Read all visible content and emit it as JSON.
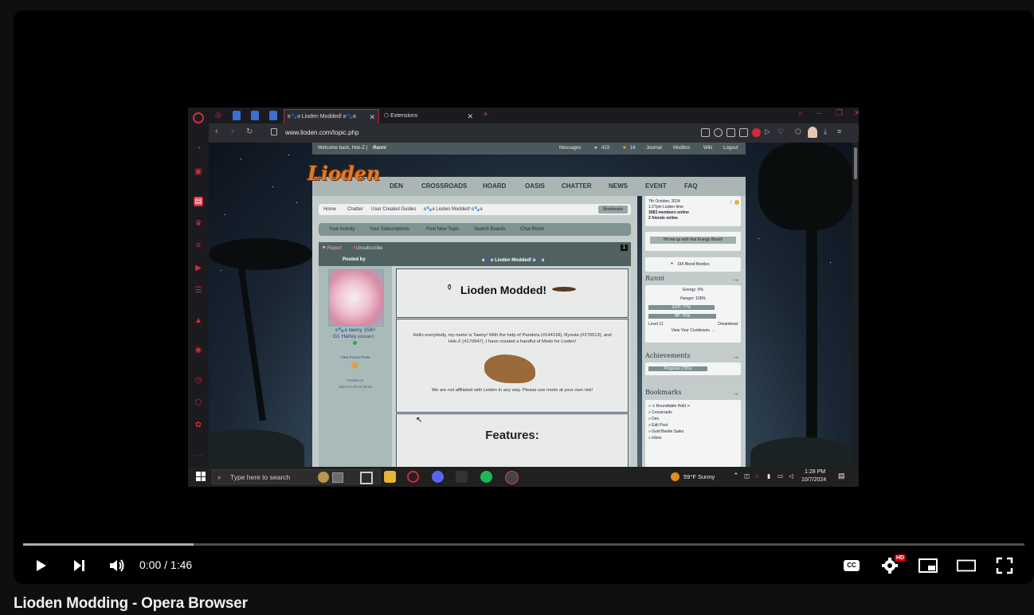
{
  "video": {
    "title": "Lioden Modding - Opera Browser",
    "time_current": "0:00",
    "time_sep": " / ",
    "time_total": "1:46",
    "played_fraction": 0.0,
    "buffered_fraction": 0.17,
    "hd_badge": "HD",
    "cc_label": "CC"
  },
  "browser": {
    "tabs": [
      {
        "label": "ʚ🐾ɞ Lioden Modded! ʚ🐾ɞ",
        "active": true
      },
      {
        "label": "Extensions",
        "active": false
      }
    ],
    "url": "www.lioden.com/topic.php"
  },
  "site": {
    "userbar": {
      "welcome": "Welcome back, Hok-Z |",
      "user": "Ranni",
      "messages": "Messages",
      "count1": "423",
      "count2": "16",
      "links": [
        "Journal",
        "Modbox",
        "Wiki",
        "Logout"
      ]
    },
    "logo": "Lioden",
    "nav": [
      "DEN",
      "CROSSROADS",
      "HOARD",
      "OASIS",
      "CHATTER",
      "NEWS",
      "EVENT",
      "FAQ"
    ],
    "breadcrumb": [
      "Home",
      "Chatter",
      "User Created Guides",
      "ʚ🐾ɞ Lioden Modded! ʚ🐾ɞ"
    ],
    "bookmark_btn": "Bookmark",
    "subnav": [
      "Your Activity",
      "Your Subscriptions",
      "Post New Topic",
      "Search Boards",
      "Chat Room"
    ],
    "post": {
      "report": "Report",
      "unsubscribe": "Unsubscribe",
      "page": "1",
      "posted_by": "Posted by",
      "topic_title": "ʚ🐾ɞ Lioden Modded! ʚ🐾ɞ",
      "author_name": "ʚ🐾ɞ tawny 1580",
      "author_sub": "G1 Harley",
      "author_id": "(#231587)",
      "view_posts": "View Forum Posts",
      "posted_on_label": "Posted on",
      "posted_on": "2024-10-06 13:35:35",
      "banner_title": "Lioden Modded!",
      "intro": "Hello everybody, my name is Tawny! With the help of Pandora (#144118), Ryouta (#276513), and Hok-Z (#170947), I have created a handful of Mods for Lioden!",
      "disclaimer": "We are not affiliated with Lioden in any way. Please use mods at your own risk!",
      "features": "Features:"
    },
    "sidebar": {
      "date": "7th October, 2024",
      "time": "1:27pm Lioden time",
      "members": "3083 members online",
      "friends": "2 friends online",
      "energy_boost": "Hit me up with that Energy Boost!",
      "beetles": "154 Blood Beetles",
      "lion_name": "Ranni",
      "energy": "Energy: 0%",
      "hunger": "Hunger: 100%",
      "exp": "EXP: 77%",
      "hp": "HP: 75%",
      "level": "Level 11",
      "title": "Dreamboat",
      "cooldowns": "View Your Cooldowns →",
      "achievements": "Achievements",
      "progress": "Progress (70%)",
      "bookmarks_title": "Bookmarks",
      "bookmarks": [
        "» ≺ Roundtable Hold ≻",
        "» Crossroads",
        "» Den",
        "» Edit Post",
        "» Gold Beetle Sales",
        "» Inbox"
      ]
    }
  },
  "taskbar": {
    "search_placeholder": "Type here to search",
    "weather": "59°F  Sunny",
    "time": "1:28 PM",
    "date": "10/7/2024"
  }
}
